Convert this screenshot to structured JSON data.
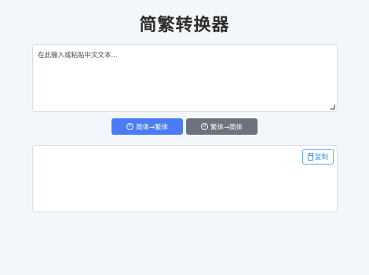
{
  "page": {
    "title": "简繁转换器"
  },
  "input": {
    "placeholder": "在此输入或粘贴中文文本..."
  },
  "buttons": {
    "to_traditional": {
      "icon": "refresh-icon",
      "label": "简体→繁体"
    },
    "to_simplified": {
      "icon": "refresh-icon",
      "label": "繁体→简体"
    }
  },
  "output": {
    "text": "",
    "copy_label": "复制",
    "copy_icon": "clipboard-icon"
  },
  "colors": {
    "background": "#f3f6fb",
    "primary_button": "#4c7cf3",
    "secondary_button": "#6c737d",
    "copy_accent": "#4a90e2"
  }
}
